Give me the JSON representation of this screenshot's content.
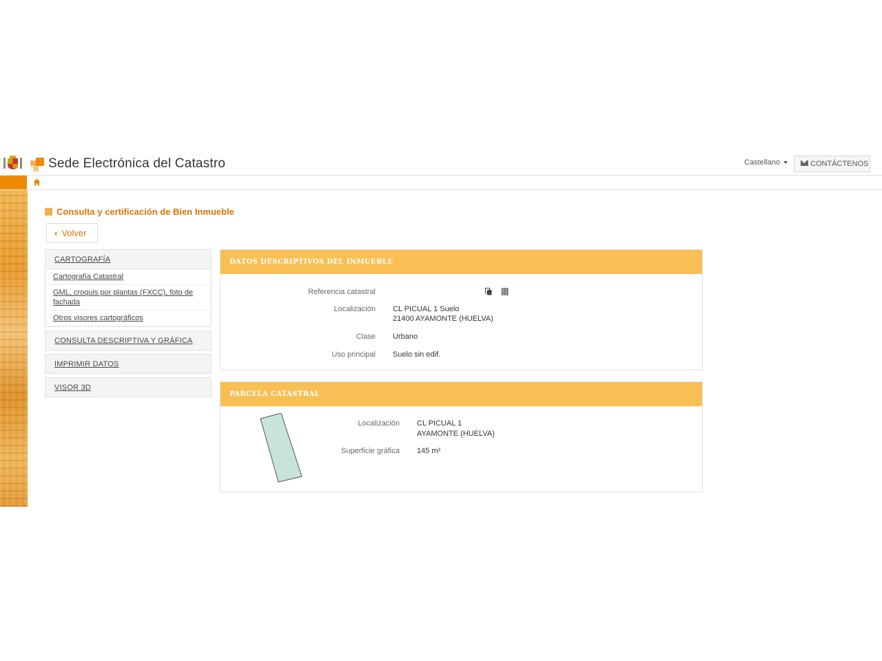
{
  "header": {
    "site_title": "Sede Electrónica del Catastro",
    "language": "Castellano",
    "contact_label": "CONTÁCTENOS"
  },
  "page": {
    "title": "Consulta y certificación de Bien Inmueble",
    "back_label": "Volver"
  },
  "sidebar": {
    "sections": [
      {
        "label": "CARTOGRAFÍA",
        "items": [
          "Cartografía Catastral",
          "GML, croquis por plantas (FXCC), foto de fachada",
          "Otros visores cartográficos"
        ]
      },
      {
        "label": "CONSULTA DESCRIPTIVA Y GRÁFICA"
      },
      {
        "label": "IMPRIMIR DATOS"
      },
      {
        "label": "VISOR 3D"
      }
    ]
  },
  "datos": {
    "title": "DATOS DESCRIPTIVOS DEL INMUEBLE",
    "ref_label": "Referencia catastral",
    "ref_value": "",
    "loc_label": "Localización",
    "loc_line1": "CL PICUAL 1 Suelo",
    "loc_line2": "21400 AYAMONTE (HUELVA)",
    "clase_label": "Clase",
    "clase_value": "Urbano",
    "uso_label": "Uso principal",
    "uso_value": "Suelo sin edif."
  },
  "parcela": {
    "title": "PARCELA CATASTRAL",
    "loc_label": "Localización",
    "loc_line1": "CL PICUAL 1",
    "loc_line2": "AYAMONTE (HUELVA)",
    "sup_label": "Superficie gráfica",
    "sup_value": "145 m²"
  },
  "icons": {
    "home": "home-icon",
    "contact": "envelope-icon",
    "copy": "copy-icon",
    "barcode": "barcode-icon"
  },
  "colors": {
    "accent": "#ef8a00",
    "panel_header": "#f8bf55",
    "title_text": "#d97400",
    "parcel_fill": "#c7e3dc"
  }
}
